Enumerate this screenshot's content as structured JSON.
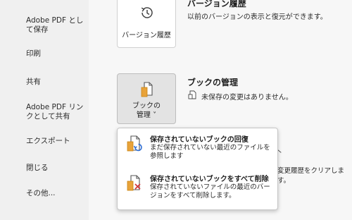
{
  "sidebar": {
    "items": [
      {
        "label": "Adobe PDF とし\nて保存"
      },
      {
        "label": "印刷"
      },
      {
        "label": "共有"
      },
      {
        "label": "Adobe PDF リン\nクとして共有"
      },
      {
        "label": "エクスポート"
      },
      {
        "label": "閉じる"
      },
      {
        "label": "その他..."
      }
    ]
  },
  "version_history": {
    "title": "バージョン履歴",
    "description": "以前のバージョンの表示と復元ができます。",
    "button_label": "バージョン履歴"
  },
  "manage_book": {
    "title": "ブックの管理",
    "status": "未保存の変更はありません。",
    "button_label_line1": "ブックの",
    "button_label_line2": "管理 ˅"
  },
  "background_text": {
    "clear_history": "変更履歴をクリアします。"
  },
  "dropdown": {
    "items": [
      {
        "title": "保存されていないブックの回復",
        "description": "まだ保存されていない最近のファイルを参照します"
      },
      {
        "title": "保存されていないブックをすべて削除",
        "description": "保存されていないファイルの最近のバージョンをすべて削除します。"
      }
    ]
  },
  "colors": {
    "file_orange": "#e8a33a",
    "recover_blue": "#2f6fd6",
    "delete_red": "#d13438"
  }
}
